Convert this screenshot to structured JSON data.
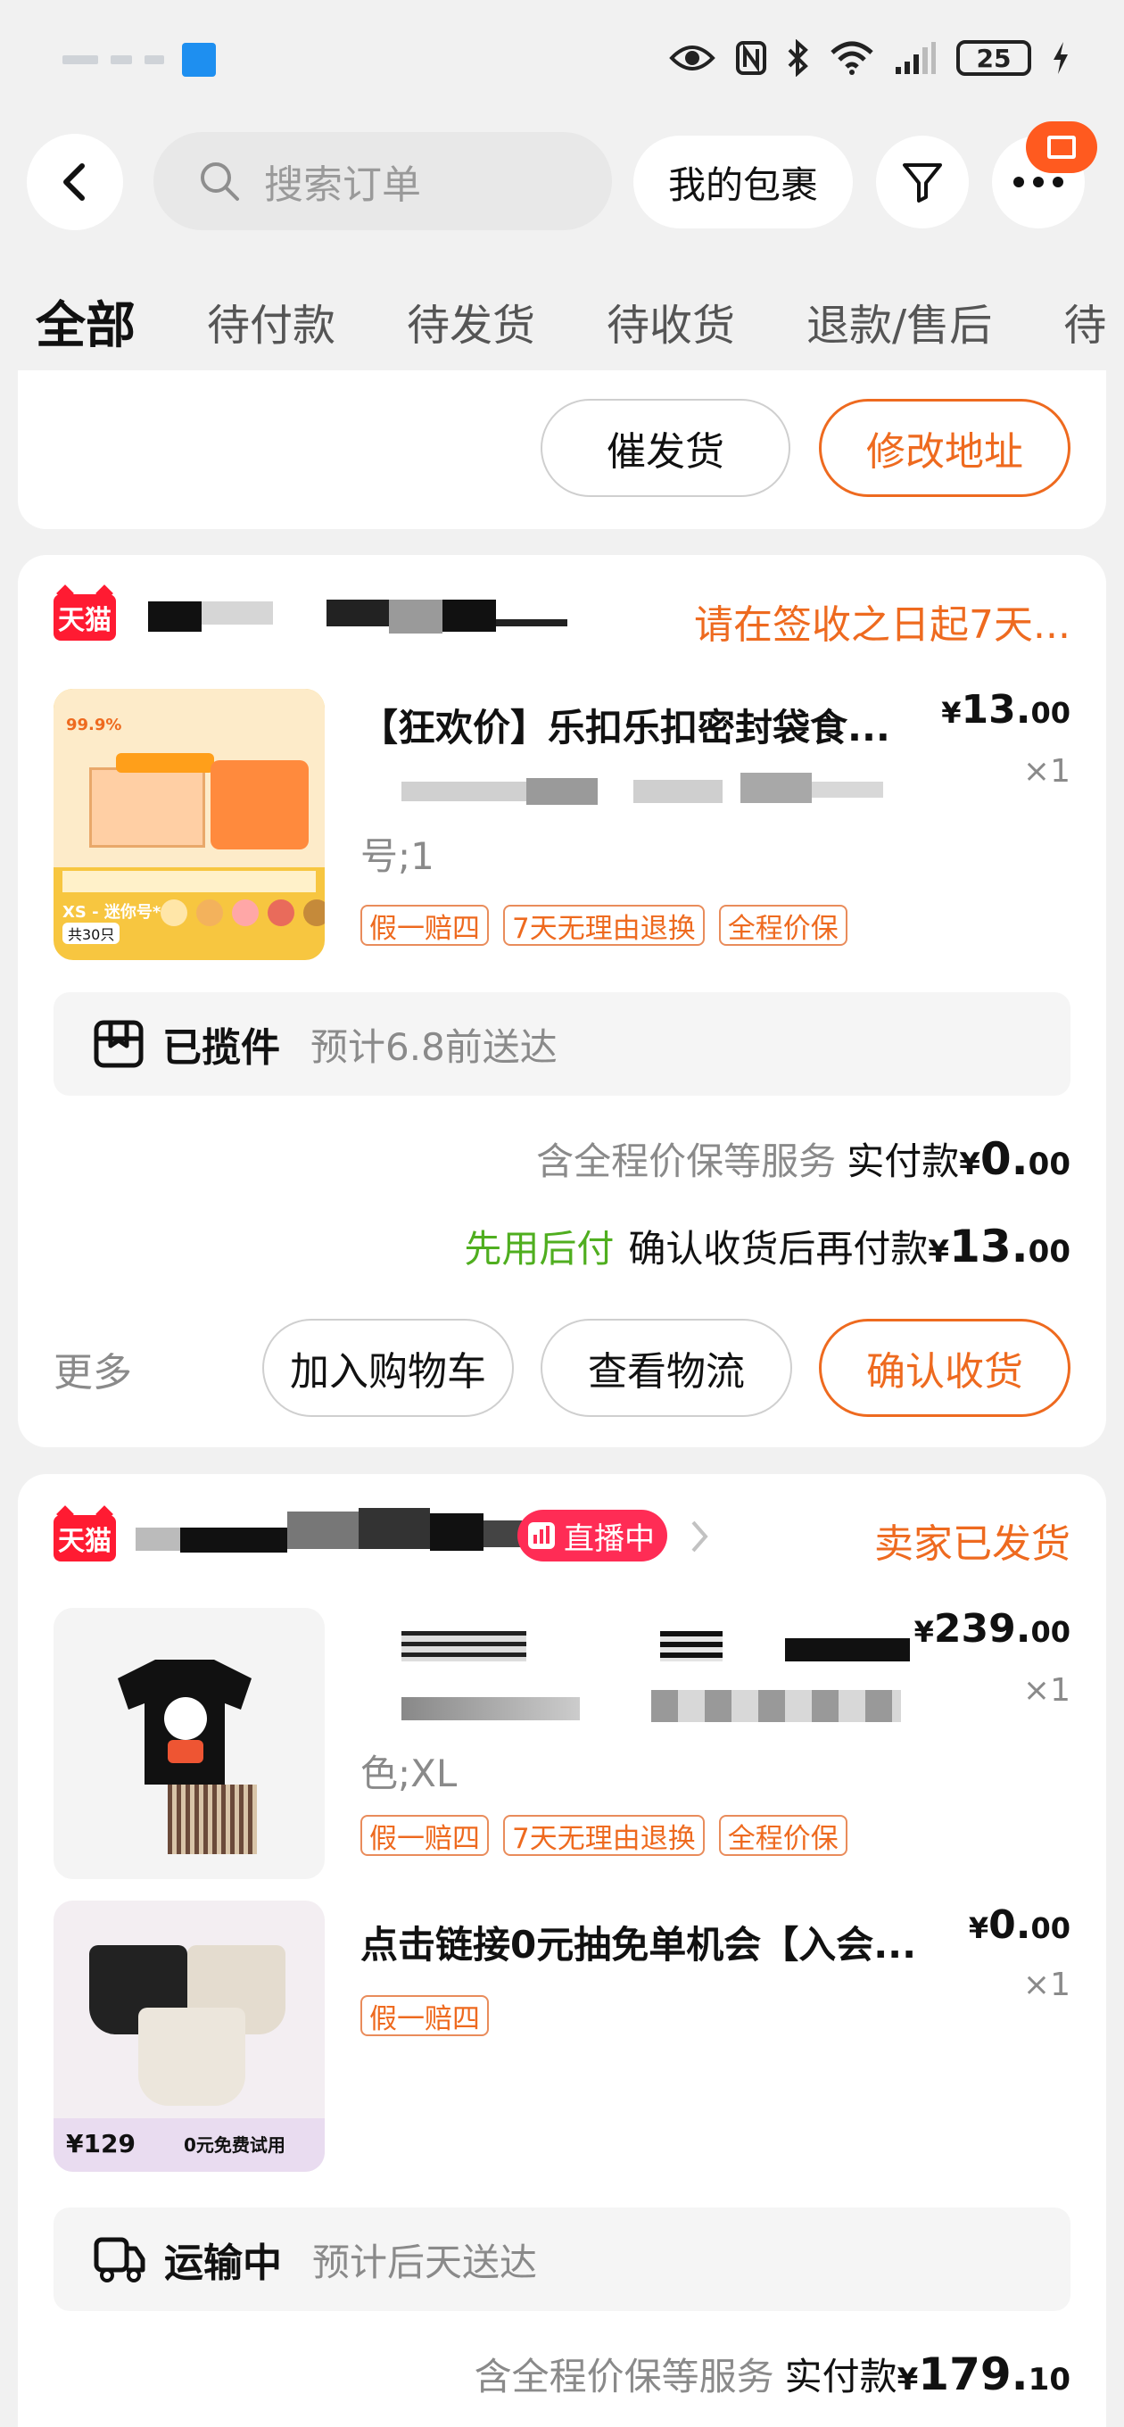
{
  "status_bar": {
    "battery": "25"
  },
  "header": {
    "search_placeholder": "搜索订单",
    "packages_label": "我的包裹"
  },
  "tabs": [
    {
      "label": "全部",
      "active": true
    },
    {
      "label": "待付款"
    },
    {
      "label": "待发货"
    },
    {
      "label": "待收货"
    },
    {
      "label": "退款/售后"
    },
    {
      "label": "待"
    }
  ],
  "partial_card": {
    "buttons": [
      "催发货",
      "修改地址"
    ]
  },
  "order1": {
    "store_badge": "天猫",
    "status": "请在签收之日起7天...",
    "item": {
      "title": "【狂欢价】乐扣乐扣密封袋食...",
      "spec_tail": "号;1",
      "price_cur": "¥",
      "price_int": "13.",
      "price_dec": "00",
      "qty": "×1",
      "tags": [
        "假一赔四",
        "7天无理由退换",
        "全程价保"
      ],
      "thumb_text": {
        "top_badge": "99.9%",
        "size_label": "XS - 迷你号*1",
        "count_label": "共30只"
      }
    },
    "logistics": {
      "status": "已揽件",
      "eta": "预计6.8前送达"
    },
    "service_note": "含全程价保等服务",
    "paid_label": "实付款",
    "paid_cur": "¥",
    "paid_int": "0.",
    "paid_dec": "00",
    "bnpl_label": "先用后付",
    "bnpl_text": "确认收货后再付款",
    "bnpl_cur": "¥",
    "bnpl_int": "13.",
    "bnpl_dec": "00",
    "more": "更多",
    "buttons": [
      "加入购物车",
      "查看物流",
      "确认收货"
    ]
  },
  "order2": {
    "store_badge": "天猫",
    "live_label": "直播中",
    "status": "卖家已发货",
    "item1": {
      "spec_tail": "色;XL",
      "price_cur": "¥",
      "price_int": "239.",
      "price_dec": "00",
      "qty": "×1",
      "tags": [
        "假一赔四",
        "7天无理由退换",
        "全程价保"
      ]
    },
    "item2": {
      "title": "点击链接0元抽免单机会【入会...",
      "price_cur": "¥",
      "price_int": "0.",
      "price_dec": "00",
      "qty": "×1",
      "tags": [
        "假一赔四"
      ],
      "thumb_text": {
        "price": "¥129",
        "promo": "0元免费试用"
      }
    },
    "logistics": {
      "status": "运输中",
      "eta": "预计后天送达"
    },
    "service_note": "含全程价保等服务",
    "paid_label": "实付款",
    "paid_cur": "¥",
    "paid_int": "179.",
    "paid_dec": "10"
  },
  "colors": {
    "accent_orange": "#ee6a1f",
    "tmall_red": "#ff1b32",
    "bnpl_green": "#4fae1f",
    "live_pink": "#ff2c55"
  }
}
